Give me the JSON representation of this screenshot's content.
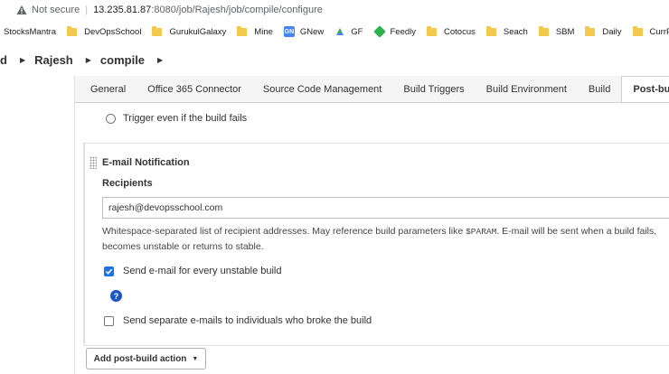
{
  "browser": {
    "security_label": "Not secure",
    "url_host": "13.235.81.87",
    "url_rest": ":8080/job/Rajesh/job/compile/configure"
  },
  "bookmarks": [
    {
      "label": "StocksMantra",
      "type": "none"
    },
    {
      "label": "DevOpsSchool",
      "type": "folder"
    },
    {
      "label": "GurukulGalaxy",
      "type": "folder"
    },
    {
      "label": "Mine",
      "type": "folder"
    },
    {
      "label": "GNew",
      "type": "gnews"
    },
    {
      "label": "GF",
      "type": "gf"
    },
    {
      "label": "Feedly",
      "type": "feedly"
    },
    {
      "label": "Cotocus",
      "type": "folder"
    },
    {
      "label": "Seach",
      "type": "folder"
    },
    {
      "label": "SBM",
      "type": "folder"
    },
    {
      "label": "Daily",
      "type": "folder"
    },
    {
      "label": "CurrPro",
      "type": "folder"
    }
  ],
  "breadcrumb": {
    "lead": "d",
    "job": "Rajesh",
    "subjob": "compile"
  },
  "tabs": [
    {
      "label": "General"
    },
    {
      "label": "Office 365 Connector"
    },
    {
      "label": "Source Code Management"
    },
    {
      "label": "Build Triggers"
    },
    {
      "label": "Build Environment"
    },
    {
      "label": "Build"
    },
    {
      "label": "Post-build Actions",
      "active": true
    }
  ],
  "trigger_option": "Trigger even if the build fails",
  "email": {
    "section_title": "E-mail Notification",
    "recipients_label": "Recipients",
    "recipients_value": "rajesh@devopsschool.com",
    "help_prefix": "Whitespace-separated list of recipient addresses. May reference build parameters like ",
    "help_param": "$PARAM",
    "help_suffix": ". E-mail will be sent when a build fails, becomes unstable or returns to stable.",
    "unstable_label": "Send e-mail for every unstable build",
    "unstable_checked": true,
    "separate_label": "Send separate e-mails to individuals who broke the build",
    "separate_checked": false
  },
  "add_action_label": "Add post-build action",
  "colors": {
    "accent": "#1a73e8",
    "help_icon": "#1a56c6",
    "folder": "#f2c94c"
  }
}
